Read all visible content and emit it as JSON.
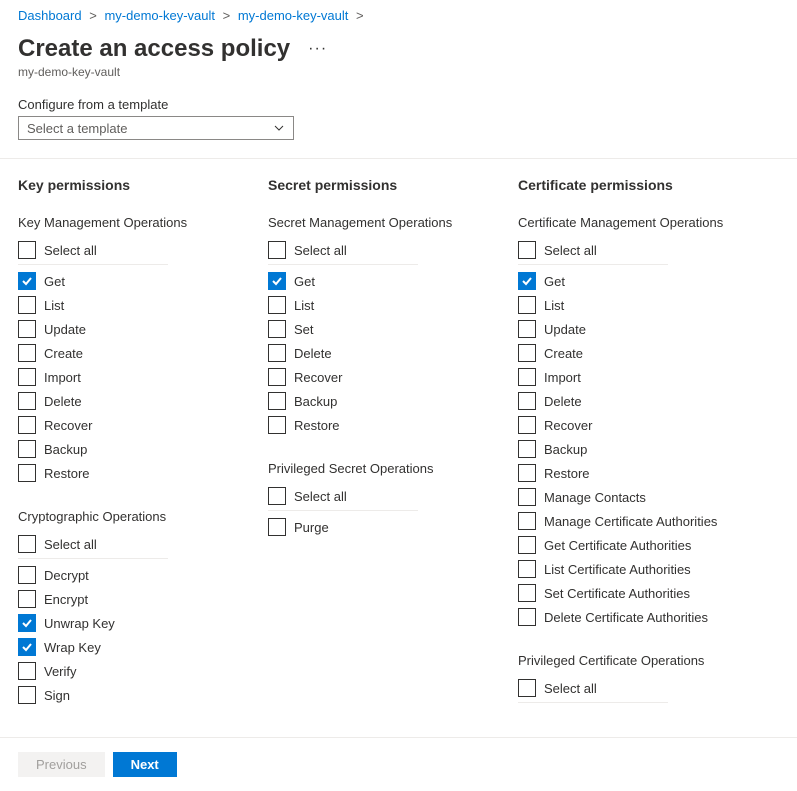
{
  "breadcrumb": {
    "items": [
      "Dashboard",
      "my-demo-key-vault",
      "my-demo-key-vault"
    ]
  },
  "page_title": "Create an access policy",
  "page_subtitle": "my-demo-key-vault",
  "template": {
    "label": "Configure from a template",
    "placeholder": "Select a template"
  },
  "columns": [
    {
      "title": "Key permissions",
      "groups": [
        {
          "title": "Key Management Operations",
          "select_all": "Select all",
          "items": [
            {
              "label": "Get",
              "checked": true
            },
            {
              "label": "List",
              "checked": false
            },
            {
              "label": "Update",
              "checked": false
            },
            {
              "label": "Create",
              "checked": false
            },
            {
              "label": "Import",
              "checked": false
            },
            {
              "label": "Delete",
              "checked": false
            },
            {
              "label": "Recover",
              "checked": false
            },
            {
              "label": "Backup",
              "checked": false
            },
            {
              "label": "Restore",
              "checked": false
            }
          ]
        },
        {
          "title": "Cryptographic Operations",
          "select_all": "Select all",
          "items": [
            {
              "label": "Decrypt",
              "checked": false
            },
            {
              "label": "Encrypt",
              "checked": false
            },
            {
              "label": "Unwrap Key",
              "checked": true
            },
            {
              "label": "Wrap Key",
              "checked": true
            },
            {
              "label": "Verify",
              "checked": false
            },
            {
              "label": "Sign",
              "checked": false
            }
          ]
        }
      ]
    },
    {
      "title": "Secret permissions",
      "groups": [
        {
          "title": "Secret Management Operations",
          "select_all": "Select all",
          "items": [
            {
              "label": "Get",
              "checked": true
            },
            {
              "label": "List",
              "checked": false
            },
            {
              "label": "Set",
              "checked": false
            },
            {
              "label": "Delete",
              "checked": false
            },
            {
              "label": "Recover",
              "checked": false
            },
            {
              "label": "Backup",
              "checked": false
            },
            {
              "label": "Restore",
              "checked": false
            }
          ]
        },
        {
          "title": "Privileged Secret Operations",
          "select_all": "Select all",
          "items": [
            {
              "label": "Purge",
              "checked": false
            }
          ]
        }
      ]
    },
    {
      "title": "Certificate permissions",
      "groups": [
        {
          "title": "Certificate Management Operations",
          "select_all": "Select all",
          "items": [
            {
              "label": "Get",
              "checked": true
            },
            {
              "label": "List",
              "checked": false
            },
            {
              "label": "Update",
              "checked": false
            },
            {
              "label": "Create",
              "checked": false
            },
            {
              "label": "Import",
              "checked": false
            },
            {
              "label": "Delete",
              "checked": false
            },
            {
              "label": "Recover",
              "checked": false
            },
            {
              "label": "Backup",
              "checked": false
            },
            {
              "label": "Restore",
              "checked": false
            },
            {
              "label": "Manage Contacts",
              "checked": false
            },
            {
              "label": "Manage Certificate Authorities",
              "checked": false
            },
            {
              "label": "Get Certificate Authorities",
              "checked": false
            },
            {
              "label": "List Certificate Authorities",
              "checked": false
            },
            {
              "label": "Set Certificate Authorities",
              "checked": false
            },
            {
              "label": "Delete Certificate Authorities",
              "checked": false
            }
          ]
        },
        {
          "title": "Privileged Certificate Operations",
          "select_all": "Select all",
          "items": []
        }
      ]
    }
  ],
  "footer": {
    "previous": "Previous",
    "next": "Next"
  }
}
